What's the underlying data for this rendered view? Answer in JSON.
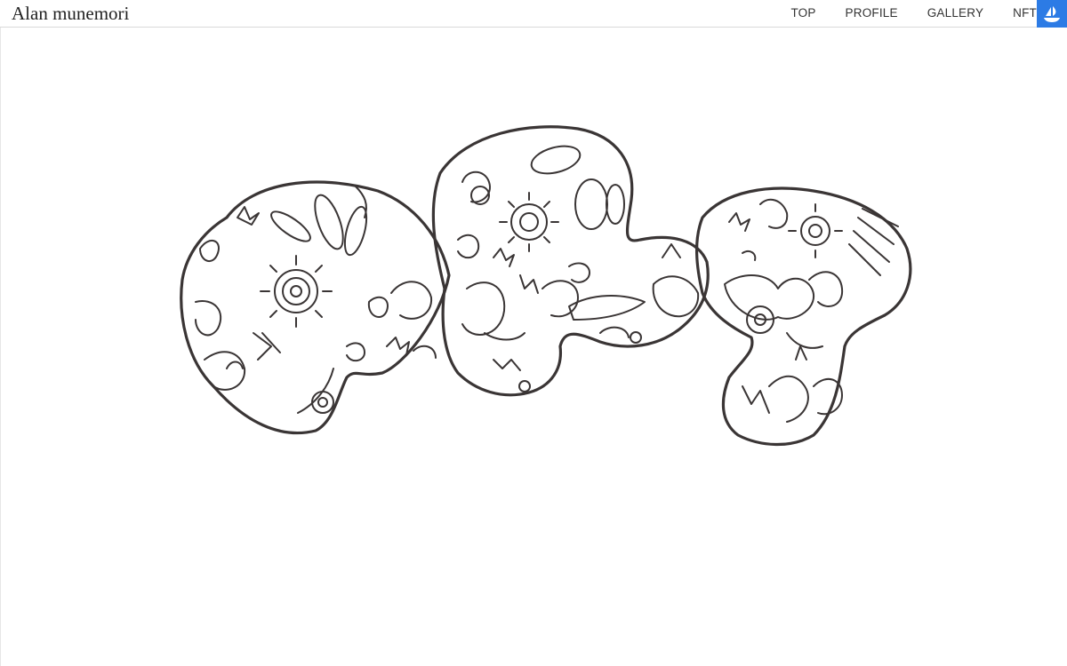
{
  "header": {
    "site_title": "Alan munemori",
    "nav": [
      {
        "label": "TOP"
      },
      {
        "label": "PROFILE"
      },
      {
        "label": "GALLERY"
      },
      {
        "label": "NFT"
      }
    ],
    "marketplace_icon": "opensea-ship-icon",
    "accent_color": "#2c7be5"
  },
  "main": {
    "artwork_icon": "doodle-artwork-image"
  }
}
